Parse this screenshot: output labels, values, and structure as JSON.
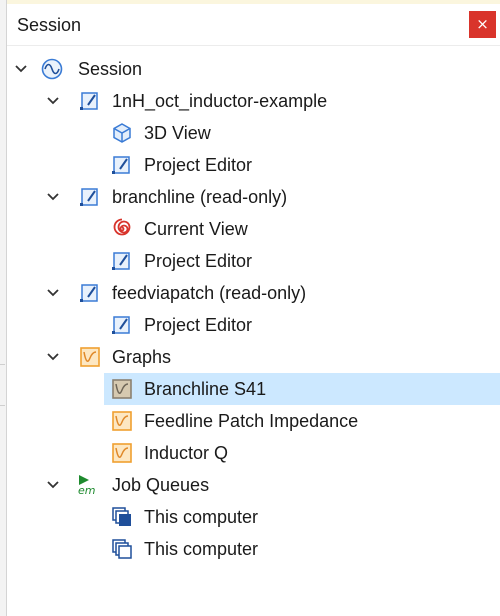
{
  "panel": {
    "title": "Session",
    "close_glyph": "×"
  },
  "tree": {
    "session": {
      "label": "Session",
      "icon": "sine-wave-icon"
    },
    "projects": [
      {
        "label": "1nH_oct_inductor-example",
        "icon": "project-edit-icon",
        "children": [
          {
            "label": "3D View",
            "icon": "cube-icon"
          },
          {
            "label": "Project Editor",
            "icon": "project-edit-icon"
          }
        ]
      },
      {
        "label": "branchline (read-only)",
        "icon": "project-edit-icon",
        "children": [
          {
            "label": "Current View",
            "icon": "spiral-icon"
          },
          {
            "label": "Project Editor",
            "icon": "project-edit-icon"
          }
        ]
      },
      {
        "label": "feedviapatch (read-only)",
        "icon": "project-edit-icon",
        "children": [
          {
            "label": "Project Editor",
            "icon": "project-edit-icon"
          }
        ]
      }
    ],
    "graphs": {
      "label": "Graphs",
      "icon": "graph-icon",
      "children": [
        {
          "label": "Branchline S41",
          "icon": "graph-icon",
          "selected": true
        },
        {
          "label": "Feedline Patch Impedance",
          "icon": "graph-icon"
        },
        {
          "label": "Inductor Q",
          "icon": "graph-icon"
        }
      ]
    },
    "job_queues": {
      "label": "Job Queues",
      "icon": "em-icon",
      "icon_text": "em",
      "children": [
        {
          "label": "This computer",
          "icon": "queue-filled-icon"
        },
        {
          "label": "This computer",
          "icon": "queue-outline-icon"
        }
      ]
    }
  },
  "colors": {
    "selection": "#cce8ff",
    "close_button": "#d9342b",
    "graph_icon": "#f0a030",
    "project_icon": "#3a7bd5",
    "spiral_icon": "#d8342c",
    "em_icon": "#1e8a2e"
  }
}
